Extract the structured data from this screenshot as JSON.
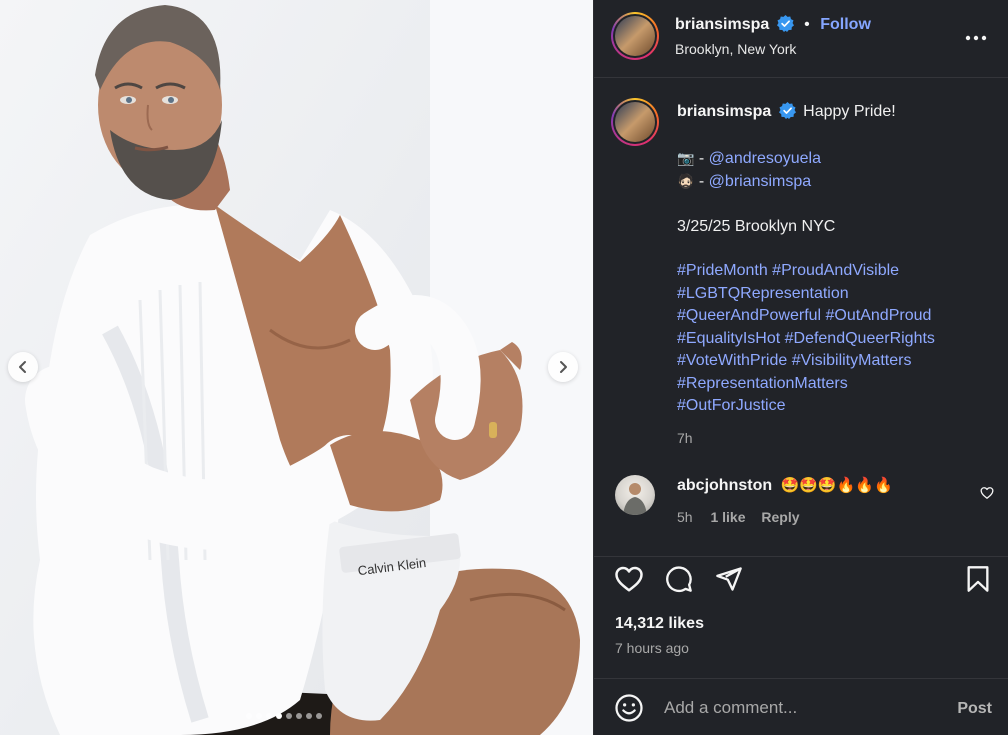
{
  "media": {
    "prev_icon": "chevron-left-icon",
    "next_icon": "chevron-right-icon",
    "slide_count": 8,
    "active_slide": 4
  },
  "header": {
    "username": "briansimspa",
    "separator": "•",
    "follow_label": "Follow",
    "location": "Brooklyn, New York"
  },
  "caption": {
    "username": "briansimspa",
    "text": "Happy Pride!",
    "camera_emoji": "📷",
    "person_emoji": "🧔🏻",
    "dash": "-",
    "credit_photo": "@andresoyuela",
    "credit_self": "@briansimspa",
    "date_place": "3/25/25 Brooklyn NYC",
    "hashtags": [
      "#PrideMonth #ProudAndVisible",
      "#LGBTQRepresentation",
      "#QueerAndPowerful #OutAndProud",
      "#EqualityIsHot #DefendQueerRights",
      "#VoteWithPride #VisibilityMatters",
      "#RepresentationMatters",
      "#OutForJustice"
    ],
    "time": "7h"
  },
  "comment": {
    "username": "abcjohnston",
    "text": "🤩🤩🤩🔥🔥🔥",
    "time": "5h",
    "likes": "1 like",
    "reply_label": "Reply"
  },
  "actions": {
    "icons": [
      "heart-icon",
      "comment-icon",
      "share-icon",
      "bookmark-icon"
    ],
    "likes": "14,312 likes",
    "ago": "7 hours ago"
  },
  "add_comment": {
    "placeholder": "Add a comment...",
    "post_label": "Post"
  },
  "colors": {
    "panel_bg": "#212328",
    "link": "#85a6ff",
    "verified": "#3897f0"
  }
}
